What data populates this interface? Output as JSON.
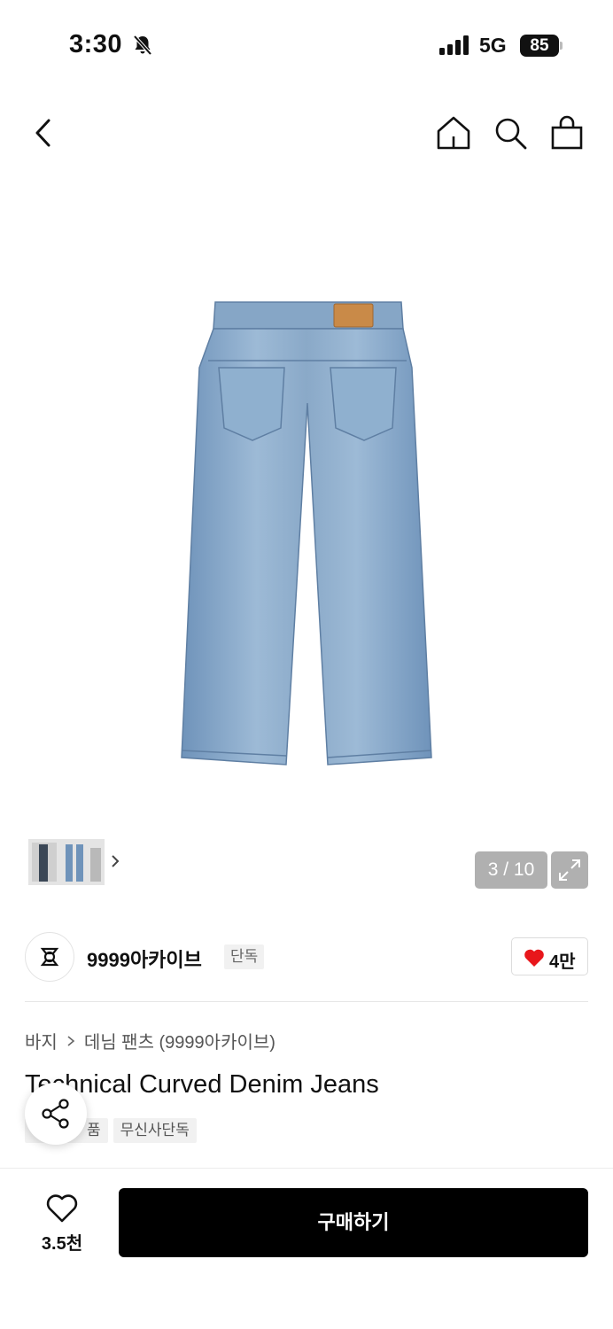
{
  "status": {
    "time": "3:30",
    "network": "5G",
    "battery": "85"
  },
  "gallery": {
    "counter": "3 / 10"
  },
  "brand": {
    "name": "9999아카이브",
    "tag": "단독",
    "likes": "4만"
  },
  "breadcrumb": [
    "바지",
    "데님 팬츠 (9999아카이브)"
  ],
  "product": {
    "title": "Technical Curved Denim Jeans",
    "tags": [
      "품",
      "무신사단독"
    ]
  },
  "bottom_bar": {
    "wish_count": "3.5천",
    "buy_label": "구매하기"
  },
  "colors": {
    "accent_heart": "#e8161b",
    "buy_button": "#000000",
    "denim": "#8fb0cf"
  }
}
